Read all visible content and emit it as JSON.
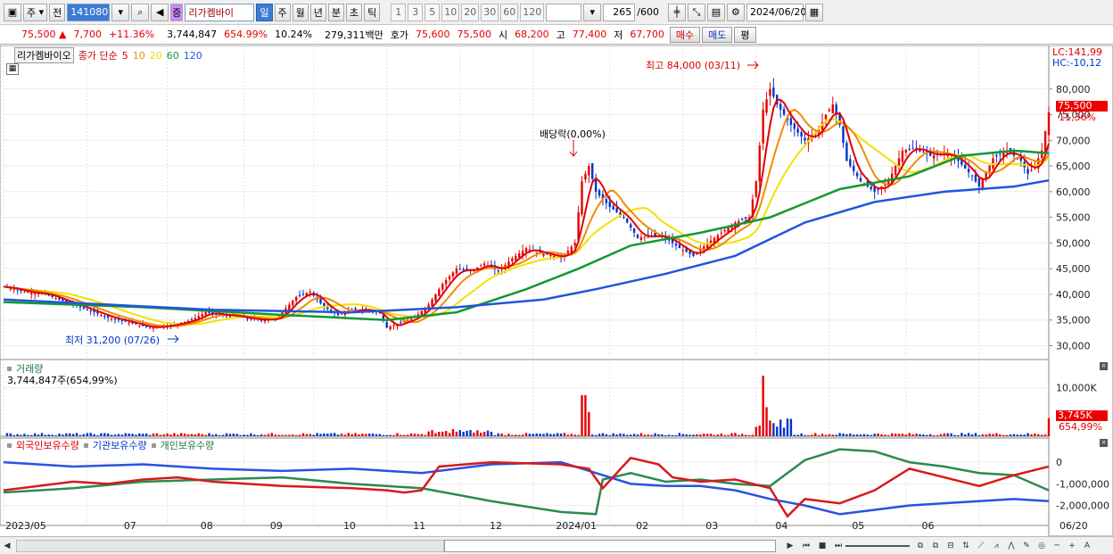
{
  "toolbar": {
    "market": "주",
    "mode": "전",
    "code": "141080",
    "name": "리가켐바이",
    "name_tag": "증",
    "periods": [
      "일",
      "주",
      "월",
      "년",
      "분",
      "초",
      "틱"
    ],
    "period_selected": "일",
    "intervals": [
      "1",
      "3",
      "5",
      "10",
      "20",
      "30",
      "60",
      "120"
    ],
    "count": "265",
    "count_max": "/600",
    "date": "2024/06/20"
  },
  "quote": {
    "price": "75,500",
    "arrow": "▲",
    "change": "7,700",
    "change_pct": "+11.36%",
    "volume": "3,744,847",
    "volume_pct": "654.99%",
    "turnover": "10.24%",
    "amount": "279,311백만",
    "bid_label": "호가",
    "bid": "75,600",
    "ask": "75,500",
    "open_label": "시",
    "open": "68,200",
    "high_label": "고",
    "high": "77,400",
    "low_label": "저",
    "low": "67,700",
    "buy": "매수",
    "sell": "매도",
    "avg": "평"
  },
  "price_panel": {
    "stock": "리가켐바이오",
    "type": "종가 단순",
    "ma": [
      {
        "p": "5",
        "c": "#e00000"
      },
      {
        "p": "10",
        "c": "#f09000"
      },
      {
        "p": "20",
        "c": "#e8e000"
      },
      {
        "p": "60",
        "c": "#119933"
      },
      {
        "p": "120",
        "c": "#2255dd"
      }
    ],
    "lc": "LC:141,99",
    "hc": "HC:-10,12",
    "max_note": "최고 84,000 (03/11)",
    "min_note": "최저 31,200 (07/26)",
    "div_note": "배당락(0,00%)",
    "last": "75,500",
    "last_pct": "11,36%"
  },
  "volume_panel": {
    "title": "거래량",
    "value": "3,744,847주(654,99%)",
    "last": "3,745K",
    "last_pct": "654,99%"
  },
  "holding_panel": {
    "s1": "외국인보유수량",
    "s2": "기관보유수량",
    "s3": "개인보유수량"
  },
  "colors": {
    "up": "#e60000",
    "down": "#0033cc",
    "red": "#d81a1a",
    "blue": "#2a52e0",
    "green": "#2b8a50"
  },
  "chart_data": {
    "type": "line",
    "price_axis_ticks": [
      80000,
      75000,
      70000,
      65000,
      60000,
      55000,
      50000,
      45000,
      40000,
      35000,
      30000
    ],
    "price_axis_labels": [
      "80,000",
      "75,000",
      "70,000",
      "65,000",
      "60,000",
      "55,000",
      "50,000",
      "45,000",
      "40,000",
      "35,000",
      "30,000"
    ],
    "volume_axis_ticks": [
      10000
    ],
    "volume_axis_labels": [
      "10,000K"
    ],
    "holding_axis_ticks": [
      0,
      -1000000,
      -2000000
    ],
    "holding_axis_labels": [
      "0",
      "-1,000,000",
      "-2,000,000"
    ],
    "x_labels": [
      "2023/05",
      "07",
      "08",
      "09",
      "10",
      "11",
      "12",
      "2024/01",
      "02",
      "03",
      "04",
      "05",
      "06",
      "06/20"
    ],
    "close": [
      [
        0,
        41500
      ],
      [
        6,
        40500
      ],
      [
        12,
        40000
      ],
      [
        18,
        38500
      ],
      [
        24,
        37000
      ],
      [
        30,
        35500
      ],
      [
        36,
        34500
      ],
      [
        42,
        33500
      ],
      [
        48,
        34000
      ],
      [
        54,
        35000
      ],
      [
        58,
        36500
      ],
      [
        62,
        36000
      ],
      [
        66,
        35800
      ],
      [
        70,
        35300
      ],
      [
        74,
        35000
      ],
      [
        78,
        35200
      ],
      [
        80,
        36500
      ],
      [
        84,
        39500
      ],
      [
        88,
        40500
      ],
      [
        92,
        37500
      ],
      [
        96,
        36000
      ],
      [
        100,
        37000
      ],
      [
        104,
        37000
      ],
      [
        108,
        36300
      ],
      [
        110,
        33500
      ],
      [
        114,
        34500
      ],
      [
        118,
        35500
      ],
      [
        122,
        38000
      ],
      [
        126,
        42000
      ],
      [
        130,
        45000
      ],
      [
        134,
        44500
      ],
      [
        138,
        46000
      ],
      [
        142,
        44500
      ],
      [
        146,
        47000
      ],
      [
        150,
        49000
      ],
      [
        154,
        48000
      ],
      [
        158,
        47500
      ],
      [
        160,
        47000
      ],
      [
        164,
        50000
      ],
      [
        166,
        62000
      ],
      [
        168,
        65000
      ],
      [
        170,
        60000
      ],
      [
        174,
        57000
      ],
      [
        178,
        55000
      ],
      [
        182,
        51000
      ],
      [
        186,
        51500
      ],
      [
        190,
        51000
      ],
      [
        194,
        49000
      ],
      [
        198,
        47500
      ],
      [
        202,
        50000
      ],
      [
        206,
        52000
      ],
      [
        210,
        54000
      ],
      [
        214,
        55000
      ],
      [
        216,
        62000
      ],
      [
        218,
        76000
      ],
      [
        220,
        80000
      ],
      [
        222,
        77000
      ],
      [
        226,
        73000
      ],
      [
        230,
        70000
      ],
      [
        234,
        72000
      ],
      [
        236,
        75000
      ],
      [
        238,
        77000
      ],
      [
        240,
        73000
      ],
      [
        242,
        66000
      ],
      [
        246,
        62000
      ],
      [
        250,
        60000
      ],
      [
        254,
        62000
      ],
      [
        256,
        65000
      ],
      [
        258,
        68000
      ],
      [
        262,
        68500
      ],
      [
        266,
        67000
      ],
      [
        270,
        67500
      ],
      [
        274,
        66000
      ],
      [
        278,
        63000
      ],
      [
        280,
        61000
      ],
      [
        284,
        66500
      ],
      [
        288,
        68000
      ],
      [
        292,
        66000
      ],
      [
        294,
        63500
      ],
      [
        296,
        65000
      ],
      [
        298,
        68000
      ],
      [
        300,
        75500
      ]
    ],
    "ma120": [
      [
        0,
        39000
      ],
      [
        60,
        37000
      ],
      [
        100,
        36500
      ],
      [
        130,
        37500
      ],
      [
        155,
        39000
      ],
      [
        170,
        41000
      ],
      [
        190,
        44000
      ],
      [
        210,
        47500
      ],
      [
        230,
        54000
      ],
      [
        250,
        58000
      ],
      [
        270,
        60000
      ],
      [
        290,
        61000
      ],
      [
        300,
        62200
      ]
    ],
    "ma60": [
      [
        0,
        38500
      ],
      [
        40,
        37500
      ],
      [
        80,
        36000
      ],
      [
        110,
        35000
      ],
      [
        130,
        36500
      ],
      [
        150,
        41000
      ],
      [
        165,
        45000
      ],
      [
        180,
        49500
      ],
      [
        200,
        52000
      ],
      [
        220,
        55000
      ],
      [
        240,
        60500
      ],
      [
        260,
        63000
      ],
      [
        275,
        67000
      ],
      [
        290,
        68000
      ],
      [
        300,
        67500
      ]
    ],
    "foreigner": [
      [
        0,
        -1300000
      ],
      [
        10,
        -1100000
      ],
      [
        20,
        -900000
      ],
      [
        30,
        -1000000
      ],
      [
        40,
        -800000
      ],
      [
        50,
        -700000
      ],
      [
        60,
        -900000
      ],
      [
        70,
        -1000000
      ],
      [
        80,
        -1100000
      ],
      [
        90,
        -1150000
      ],
      [
        100,
        -1200000
      ],
      [
        110,
        -1300000
      ],
      [
        115,
        -1400000
      ],
      [
        120,
        -1300000
      ],
      [
        125,
        -200000
      ],
      [
        140,
        0
      ],
      [
        160,
        -100000
      ],
      [
        168,
        -300000
      ],
      [
        172,
        -1200000
      ],
      [
        180,
        200000
      ],
      [
        188,
        -100000
      ],
      [
        192,
        -700000
      ],
      [
        200,
        -900000
      ],
      [
        210,
        -800000
      ],
      [
        215,
        -1000000
      ],
      [
        220,
        -1200000
      ],
      [
        225,
        -2500000
      ],
      [
        230,
        -1700000
      ],
      [
        240,
        -1900000
      ],
      [
        250,
        -1300000
      ],
      [
        260,
        -300000
      ],
      [
        270,
        -700000
      ],
      [
        280,
        -1100000
      ],
      [
        290,
        -600000
      ],
      [
        300,
        -200000
      ]
    ],
    "institution": [
      [
        0,
        0
      ],
      [
        20,
        -200000
      ],
      [
        40,
        -100000
      ],
      [
        60,
        -300000
      ],
      [
        80,
        -400000
      ],
      [
        100,
        -300000
      ],
      [
        120,
        -500000
      ],
      [
        140,
        -100000
      ],
      [
        160,
        0
      ],
      [
        170,
        -500000
      ],
      [
        180,
        -1000000
      ],
      [
        190,
        -1100000
      ],
      [
        200,
        -1100000
      ],
      [
        210,
        -1300000
      ],
      [
        220,
        -1700000
      ],
      [
        230,
        -2000000
      ],
      [
        240,
        -2400000
      ],
      [
        250,
        -2200000
      ],
      [
        260,
        -2000000
      ],
      [
        270,
        -1900000
      ],
      [
        280,
        -1800000
      ],
      [
        290,
        -1700000
      ],
      [
        300,
        -1800000
      ]
    ],
    "individual": [
      [
        0,
        -1400000
      ],
      [
        20,
        -1200000
      ],
      [
        40,
        -900000
      ],
      [
        60,
        -800000
      ],
      [
        80,
        -700000
      ],
      [
        100,
        -1000000
      ],
      [
        120,
        -1200000
      ],
      [
        140,
        -1800000
      ],
      [
        160,
        -2300000
      ],
      [
        170,
        -2400000
      ],
      [
        172,
        -800000
      ],
      [
        180,
        -500000
      ],
      [
        190,
        -900000
      ],
      [
        200,
        -800000
      ],
      [
        210,
        -1000000
      ],
      [
        220,
        -1100000
      ],
      [
        230,
        100000
      ],
      [
        240,
        600000
      ],
      [
        250,
        500000
      ],
      [
        260,
        0
      ],
      [
        270,
        -200000
      ],
      [
        280,
        -500000
      ],
      [
        290,
        -600000
      ],
      [
        300,
        -1300000
      ]
    ]
  }
}
